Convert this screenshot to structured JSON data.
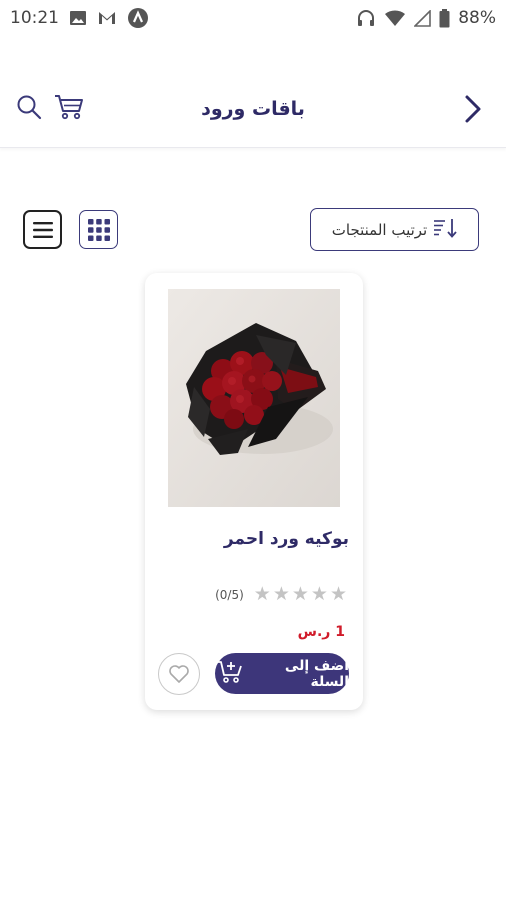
{
  "status_bar": {
    "time": "10:21",
    "battery": "88%",
    "left_icons": [
      "gallery-icon",
      "gmail-icon",
      "app-notification-icon"
    ],
    "right_icons": [
      "headphones-icon",
      "wifi-icon",
      "signal-icon",
      "battery-icon"
    ]
  },
  "header": {
    "title": "باقات ورود",
    "icons": [
      "search-icon",
      "cart-icon",
      "back-chevron-icon"
    ]
  },
  "toolbar": {
    "sort_label": "ترتيب المنتجات",
    "view_icons": [
      "list-view-icon",
      "grid-view-icon"
    ]
  },
  "product": {
    "name": "بوكيه ورد احمر",
    "rating_text": "(0/5)",
    "stars_filled": 0,
    "stars_total": 5,
    "price": "1 ر.س",
    "add_to_cart_label": "أضف إلى السلة"
  },
  "colors": {
    "primary": "#3d367a",
    "title": "#2e2a66",
    "price": "#d01b2a",
    "star_empty": "#c4c4c4"
  }
}
